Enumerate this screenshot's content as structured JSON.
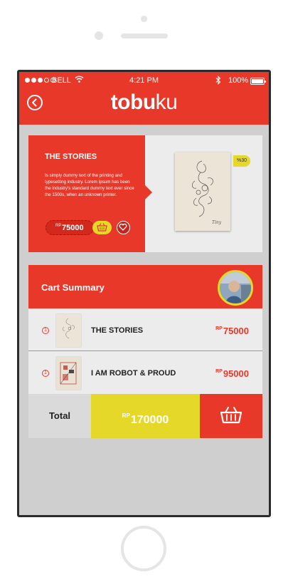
{
  "status_bar": {
    "carrier": "BELL",
    "time": "4:21 PM",
    "battery": "100%"
  },
  "navbar": {
    "logo_bold": "tobu",
    "logo_light": "ku"
  },
  "product": {
    "title": "THE STORIES",
    "description": "Is simply dummy text of the printing and typesetting industry. Lorem Ipsum has been the industry's standard dummy text ever since the 1500s, when an unknown printer.",
    "currency": "RP",
    "price": "75000",
    "discount_badge": "%30"
  },
  "cart_summary": {
    "title": "Cart Summary",
    "items": [
      {
        "qty": "1",
        "name": "THE STORIES",
        "currency": "RP",
        "price": "75000"
      },
      {
        "qty": "1",
        "name": "I AM ROBOT & PROUD",
        "currency": "RP",
        "price": "95000"
      }
    ],
    "total_label": "Total",
    "total_currency": "RP",
    "total_value": "170000"
  },
  "colors": {
    "primary_red": "#e8382a",
    "accent_yellow": "#e5d829",
    "background": "#cfcfcf"
  },
  "icons": [
    "back-arrow-icon",
    "wifi-icon",
    "bluetooth-icon",
    "battery-icon",
    "basket-icon",
    "heart-icon",
    "checkout-basket-icon"
  ]
}
